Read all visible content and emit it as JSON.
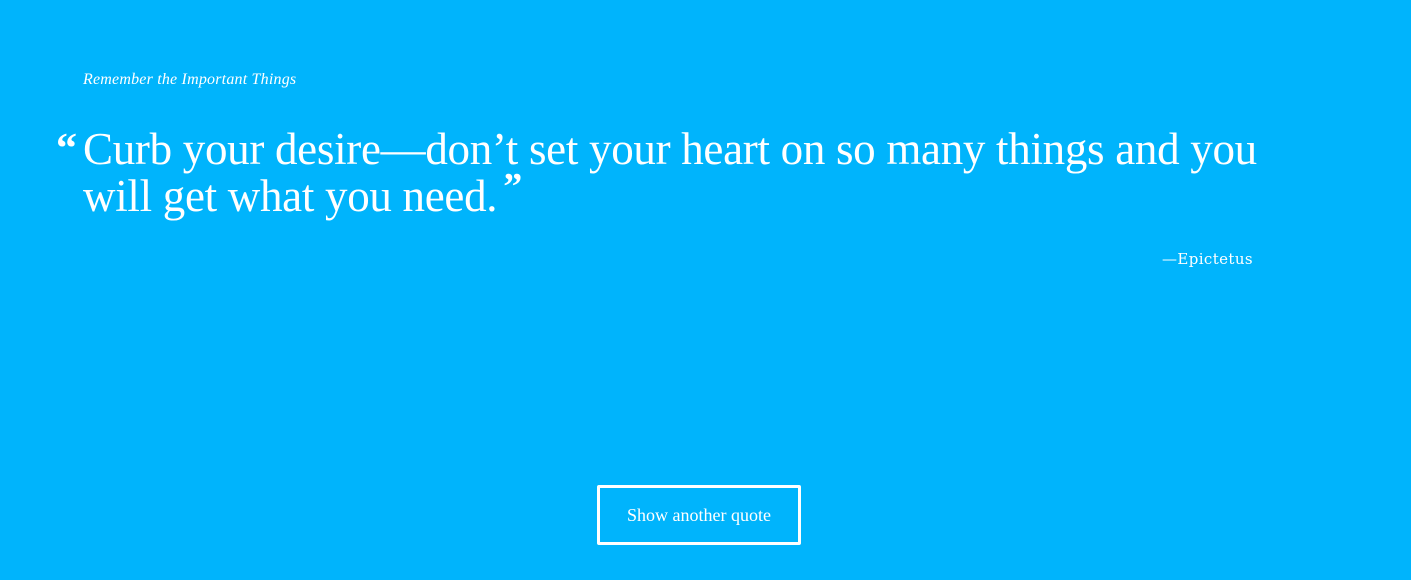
{
  "header": {
    "tagline": "Remember the Important Things"
  },
  "quote": {
    "open_mark": "“",
    "text": "Curb your desire—don’t set your heart on so many things and you will get what you need.",
    "close_mark": "”",
    "author": "—Epictetus"
  },
  "actions": {
    "new_quote_label": "Show another quote"
  },
  "colors": {
    "background": "#00b4fc",
    "foreground": "#ffffff"
  }
}
